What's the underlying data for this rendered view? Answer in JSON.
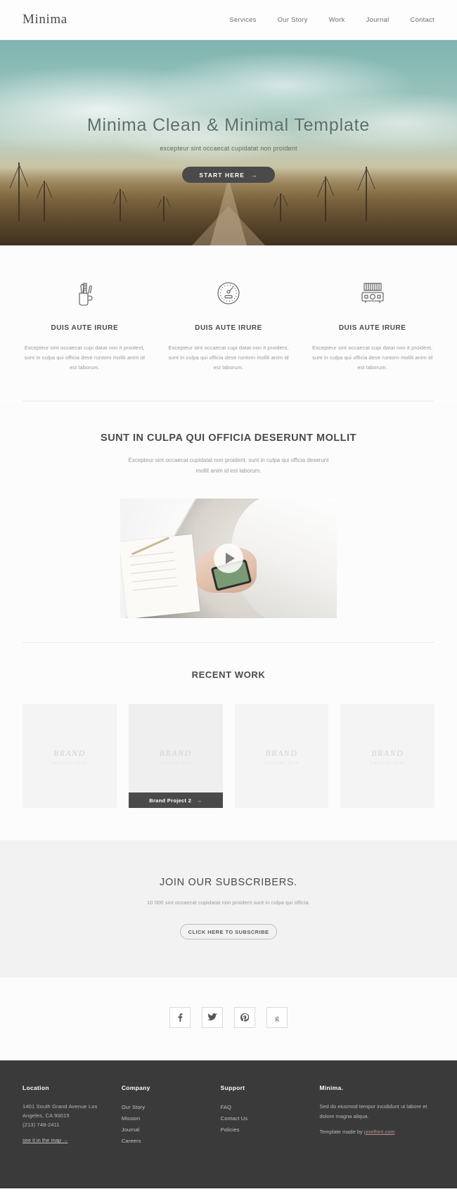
{
  "header": {
    "logo": "Minima",
    "nav": [
      {
        "label": "Services"
      },
      {
        "label": "Our Story"
      },
      {
        "label": "Work"
      },
      {
        "label": "Journal"
      },
      {
        "label": "Contact"
      }
    ]
  },
  "hero": {
    "title": "Minima Clean & Minimal Template",
    "subtitle": "excepteur sint occaecat cupidatat non proident",
    "button_label": "START HERE",
    "button_arrow": "→"
  },
  "features": [
    {
      "icon": "pen-cup-icon",
      "title": "DUIS AUTE IRURE",
      "text": "Excepteur sint occaecat cupi datat non it proident, sunt in culpa qui officia dese runtorn mollit anim id est laborum."
    },
    {
      "icon": "gauge-icon",
      "title": "DUIS AUTE IRURE",
      "text": "Excepteur sint occaecat cupi datat non it proident, sunt in culpa qui officia dese runtorn mollit anim id est laborum."
    },
    {
      "icon": "camera-icon",
      "title": "DUIS AUTE IRURE",
      "text": "Excepteur sint occaecat cupi datat non it proident, sunt in culpa qui officia dese runtorn mollit anim id est laborum."
    }
  ],
  "video_section": {
    "title": "SUNT IN CULPA QUI OFFICIA DESERUNT MOLLIT",
    "subtitle": "Excepteur sint occaecat cupidatat non proident, sunt in culpa qui officia deserunt mollit anim id est laborum.",
    "play_icon": "play-icon"
  },
  "work_section": {
    "title": "RECENT WORK",
    "items": [
      {
        "brand": "BRAND",
        "tagline": "logotype  here",
        "overlay": null
      },
      {
        "brand": "BRAND",
        "tagline": "logotype  here",
        "overlay": "Brand Project 2",
        "overlay_arrow": "→"
      },
      {
        "brand": "BRAND",
        "tagline": "logotype  here",
        "overlay": null
      },
      {
        "brand": "BRAND",
        "tagline": "logotype  here",
        "overlay": null
      }
    ]
  },
  "subscribe": {
    "title": "JOIN OUR SUBSCRIBERS.",
    "text": "10 000 sint occaecat cupidatat non proident sunt in culpa qui officia.",
    "button_label": "CLICK HERE TO SUBSCRIBE"
  },
  "social": [
    {
      "name": "facebook-icon",
      "glyph": "f"
    },
    {
      "name": "twitter-icon",
      "glyph": "t"
    },
    {
      "name": "pinterest-icon",
      "glyph": "p"
    },
    {
      "name": "google-plus-icon",
      "glyph": "g"
    }
  ],
  "footer": {
    "columns": [
      {
        "title": "Location",
        "address": "1401 South Grand Avenue Los Angeles, CA 90015",
        "phone": "(213) 748-2411",
        "map_link": "see it in the map  →"
      },
      {
        "title": "Company",
        "links": [
          "Our Story",
          "Mission",
          "Journal",
          "Careers"
        ]
      },
      {
        "title": "Support",
        "links": [
          "FAQ",
          "Contact Us",
          "Policies"
        ]
      },
      {
        "title": "Minima.",
        "text": "Sed do eiusmod tempor incididunt ut labore et dolore magna aliqua.",
        "made_by_prefix": "Template made by ",
        "made_by_link": "pixelhint.com"
      }
    ]
  },
  "colors": {
    "dark": "#3a3a3a",
    "text": "#4a4a4a",
    "muted": "#9a9a9a",
    "panel": "#f2f2f2"
  }
}
